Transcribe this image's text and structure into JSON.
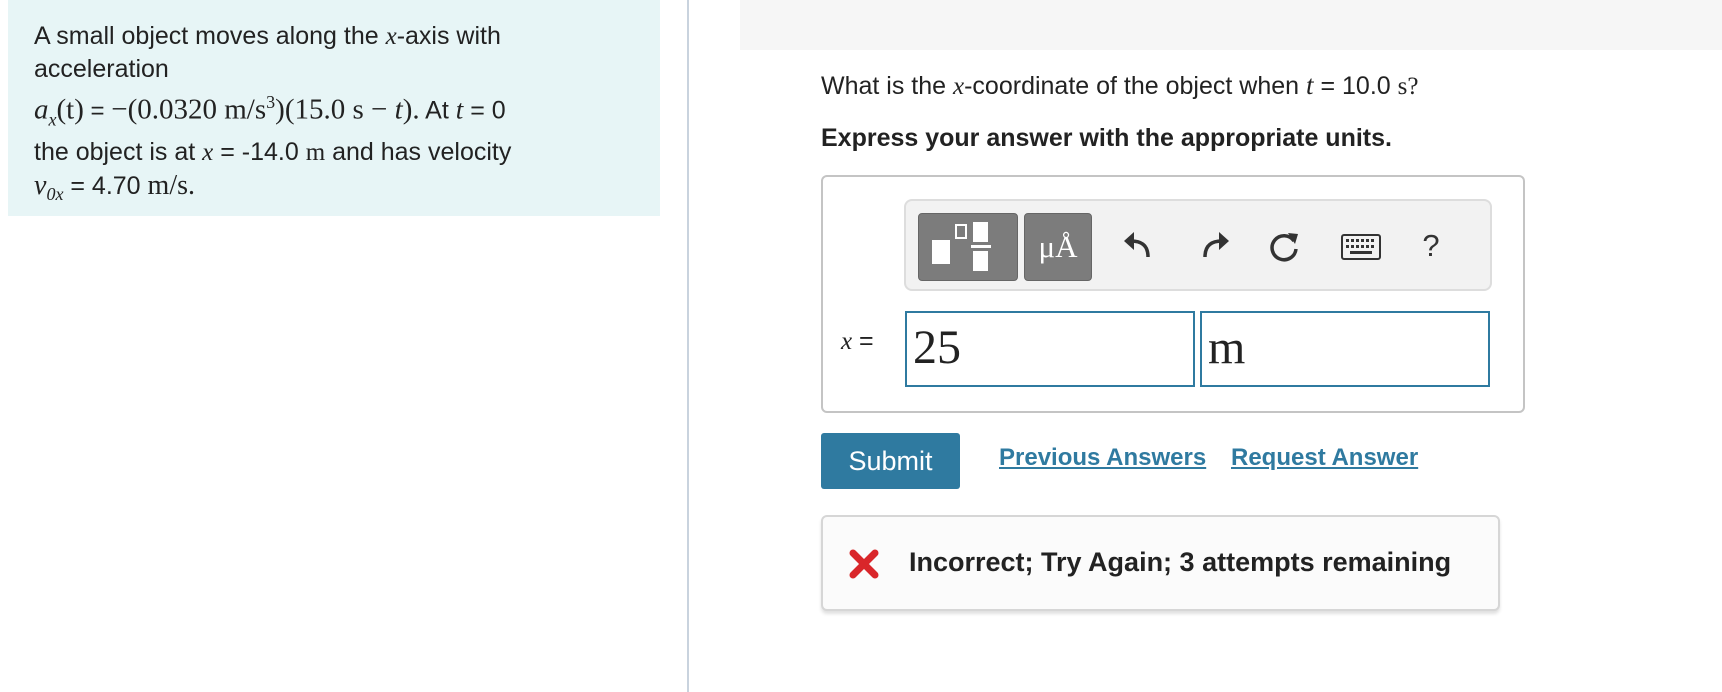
{
  "problem": {
    "line1_prefix": "A small object moves along the ",
    "x_var": "x",
    "line1_suffix": "-axis with",
    "line2": "acceleration",
    "accel_lhs": "a",
    "accel_sub": "x",
    "accel_t": "(t)",
    "accel_eq": " = ",
    "accel_rhs_a": "−(0.0320 m/s",
    "accel_rhs_exp": "3",
    "accel_rhs_b": ")(15.0 s − ",
    "accel_rhs_t": "t",
    "accel_rhs_c": ").",
    "at_text": " At ",
    "t_var": "t",
    "t_eq": " = 0",
    "line4_prefix": "the object is at ",
    "x_eq": " = -14.0 ",
    "x_unit": "m",
    "line4_suffix": " and has velocity",
    "v_sym": "v",
    "v_sub": "0x",
    "v_eq": " = 4.70 ",
    "v_unit": "m/s."
  },
  "question": {
    "prefix": "What is the ",
    "x_var": "x",
    "middle": "-coordinate of the object when ",
    "t_var": "t",
    "suffix": " = 10.0 ",
    "unit": "s?"
  },
  "instructions": "Express your answer with the appropriate units.",
  "toolbar": {
    "units_label": "μÅ",
    "help_label": "?",
    "icons": [
      "templates-icon",
      "units-icon",
      "undo-icon",
      "redo-icon",
      "reset-icon",
      "keyboard-icon",
      "help-icon"
    ]
  },
  "answer": {
    "var": "x",
    "eq": " =",
    "value": "25",
    "unit": "m"
  },
  "actions": {
    "submit": "Submit",
    "previous_answers": "Previous Answers",
    "request_answer": "Request Answer"
  },
  "feedback": {
    "text": "Incorrect; Try Again; 3 attempts remaining",
    "icon": "x-mark-icon"
  },
  "colors": {
    "panel_bg": "#e7f5f6",
    "accent": "#2f7aa0",
    "error": "#d9262a"
  }
}
